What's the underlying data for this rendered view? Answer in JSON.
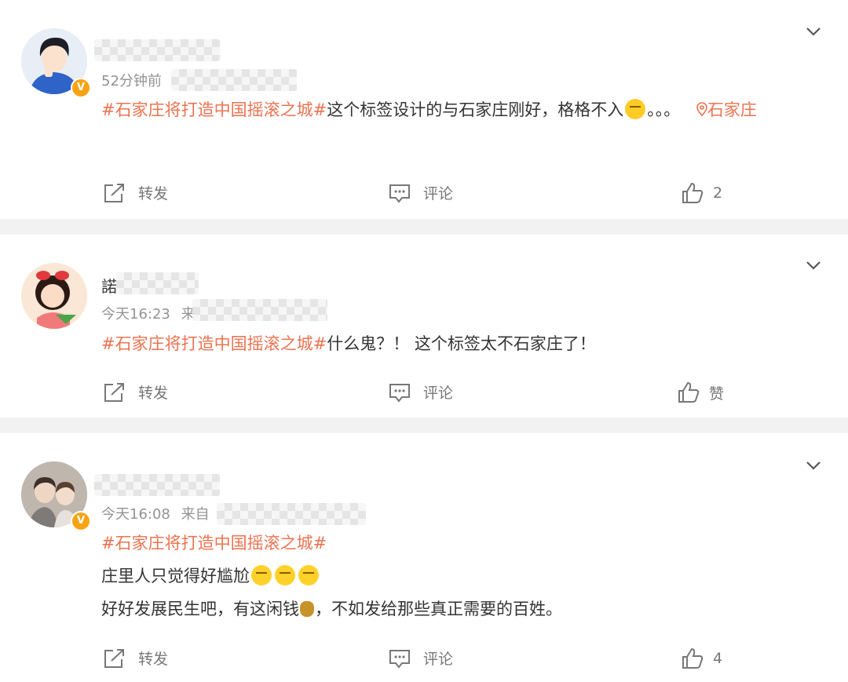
{
  "posts": [
    {
      "time": "52分钟前",
      "source_prefix": "",
      "topic": "#石家庄将打造中国摇滚之城#",
      "body_line1": "这个标签设计的与石家庄刚好，格格不入",
      "emoji_after": "laugh-cry-emoji",
      "body_tail": "。。。",
      "location_icon": "location-pin-icon",
      "location": "石家庄",
      "name_visible": "",
      "actions": {
        "repost": "转发",
        "comment": "评论",
        "like": "2"
      }
    },
    {
      "time": "今天16:23",
      "source_prefix": "来",
      "topic": "#石家庄将打造中国摇滚之城#",
      "body_line1": "什么鬼？！ 这个标签太不石家庄了！",
      "name_visible": "諾",
      "actions": {
        "repost": "转发",
        "comment": "评论",
        "like": "赞"
      }
    },
    {
      "time": "今天16:08",
      "source_prefix": "来自",
      "topic": "#石家庄将打造中国摇滚之城#",
      "body_line2": "庄里人只觉得好尴尬",
      "body_line3_a": "好好发展民生吧，有这闲钱",
      "body_line3_b": "，不如发给那些真正需要的百姓。",
      "name_visible": "",
      "actions": {
        "repost": "转发",
        "comment": "评论",
        "like": "4"
      }
    }
  ],
  "colors": {
    "topic": "#eb7350",
    "meta": "#939393",
    "badge": "#f7a413",
    "background": "#f2f2f2"
  },
  "icons": [
    "chevron-down-icon",
    "repost-icon",
    "comment-icon",
    "like-icon",
    "verified-badge-icon",
    "money-bag-emoji",
    "awkward-emoji"
  ]
}
